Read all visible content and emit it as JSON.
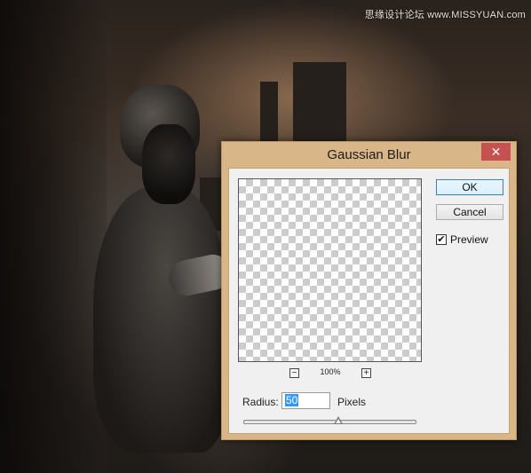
{
  "watermark": "思缘设计论坛 www.MISSYUAN.com",
  "dialog": {
    "title": "Gaussian Blur",
    "close_glyph": "✕",
    "zoom_out_glyph": "−",
    "zoom_in_glyph": "+",
    "zoom_level": "100%",
    "ok_label": "OK",
    "cancel_label": "Cancel",
    "preview_label": "Preview",
    "preview_checked": true,
    "check_glyph": "✔",
    "radius_label": "Radius:",
    "radius_value": "50",
    "radius_unit": "Pixels",
    "slider_fraction": 0.55
  },
  "colors": {
    "dialog_frame": "#d8b687",
    "close_button": "#c75050",
    "selection": "#3399ff"
  }
}
